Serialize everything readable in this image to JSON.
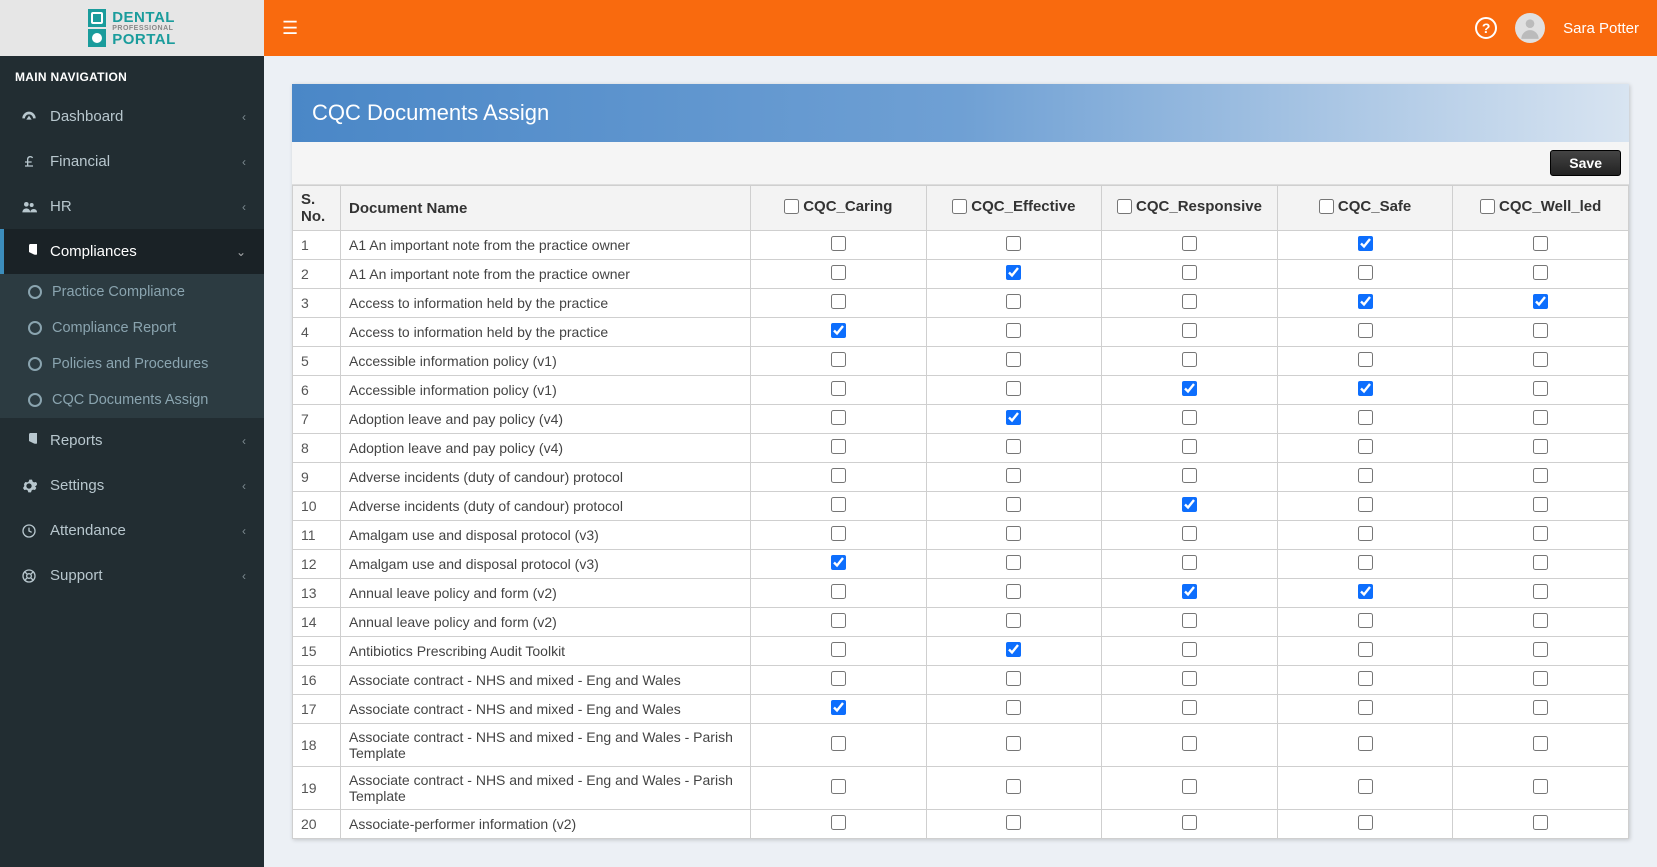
{
  "logo": {
    "line1": "DENTAL",
    "line2": "PROFESSIONAL",
    "line3": "PORTAL"
  },
  "nav_header": "MAIN NAVIGATION",
  "nav": {
    "items": [
      {
        "label": "Dashboard",
        "icon": "gauge"
      },
      {
        "label": "Financial",
        "icon": "pound"
      },
      {
        "label": "HR",
        "icon": "users"
      },
      {
        "label": "Compliances",
        "icon": "pie"
      },
      {
        "label": "Reports",
        "icon": "pie"
      },
      {
        "label": "Settings",
        "icon": "gear"
      },
      {
        "label": "Attendance",
        "icon": "clock"
      },
      {
        "label": "Support",
        "icon": "life"
      }
    ]
  },
  "subnav": {
    "items": [
      {
        "label": "Practice Compliance"
      },
      {
        "label": "Compliance Report"
      },
      {
        "label": "Policies and Procedures"
      },
      {
        "label": "CQC Documents Assign"
      }
    ]
  },
  "user": {
    "name": "Sara Potter"
  },
  "panel": {
    "title": "CQC Documents Assign",
    "save_label": "Save"
  },
  "columns": {
    "sn": "S. No.",
    "doc": "Document Name",
    "cols": [
      "CQC_Caring",
      "CQC_Effective",
      "CQC_Responsive",
      "CQC_Safe",
      "CQC_Well_led"
    ]
  },
  "rows": [
    {
      "n": "1",
      "name": "A1 An important note from the practice owner",
      "c": [
        false,
        false,
        false,
        true,
        false
      ]
    },
    {
      "n": "2",
      "name": "A1 An important note from the practice owner",
      "c": [
        false,
        true,
        false,
        false,
        false
      ]
    },
    {
      "n": "3",
      "name": "Access to information held by the practice",
      "c": [
        false,
        false,
        false,
        true,
        true
      ]
    },
    {
      "n": "4",
      "name": "Access to information held by the practice",
      "c": [
        true,
        false,
        false,
        false,
        false
      ]
    },
    {
      "n": "5",
      "name": "Accessible information policy (v1)",
      "c": [
        false,
        false,
        false,
        false,
        false
      ]
    },
    {
      "n": "6",
      "name": "Accessible information policy (v1)",
      "c": [
        false,
        false,
        true,
        true,
        false
      ]
    },
    {
      "n": "7",
      "name": "Adoption leave and pay policy (v4)",
      "c": [
        false,
        true,
        false,
        false,
        false
      ]
    },
    {
      "n": "8",
      "name": "Adoption leave and pay policy (v4)",
      "c": [
        false,
        false,
        false,
        false,
        false
      ]
    },
    {
      "n": "9",
      "name": "Adverse incidents (duty of candour) protocol",
      "c": [
        false,
        false,
        false,
        false,
        false
      ]
    },
    {
      "n": "10",
      "name": "Adverse incidents (duty of candour) protocol",
      "c": [
        false,
        false,
        true,
        false,
        false
      ]
    },
    {
      "n": "11",
      "name": "Amalgam use and disposal protocol (v3)",
      "c": [
        false,
        false,
        false,
        false,
        false
      ]
    },
    {
      "n": "12",
      "name": "Amalgam use and disposal protocol (v3)",
      "c": [
        true,
        false,
        false,
        false,
        false
      ]
    },
    {
      "n": "13",
      "name": "Annual leave policy and form (v2)",
      "c": [
        false,
        false,
        true,
        true,
        false
      ]
    },
    {
      "n": "14",
      "name": "Annual leave policy and form (v2)",
      "c": [
        false,
        false,
        false,
        false,
        false
      ]
    },
    {
      "n": "15",
      "name": "Antibiotics Prescribing Audit Toolkit",
      "c": [
        false,
        true,
        false,
        false,
        false
      ]
    },
    {
      "n": "16",
      "name": "Associate contract - NHS and mixed - Eng and Wales",
      "c": [
        false,
        false,
        false,
        false,
        false
      ]
    },
    {
      "n": "17",
      "name": "Associate contract - NHS and mixed - Eng and Wales",
      "c": [
        true,
        false,
        false,
        false,
        false
      ]
    },
    {
      "n": "18",
      "name": "Associate contract - NHS and mixed - Eng and Wales - Parish Template",
      "c": [
        false,
        false,
        false,
        false,
        false
      ]
    },
    {
      "n": "19",
      "name": "Associate contract - NHS and mixed - Eng and Wales - Parish Template",
      "c": [
        false,
        false,
        false,
        false,
        false
      ]
    },
    {
      "n": "20",
      "name": "Associate-performer information (v2)",
      "c": [
        false,
        false,
        false,
        false,
        false
      ]
    }
  ]
}
